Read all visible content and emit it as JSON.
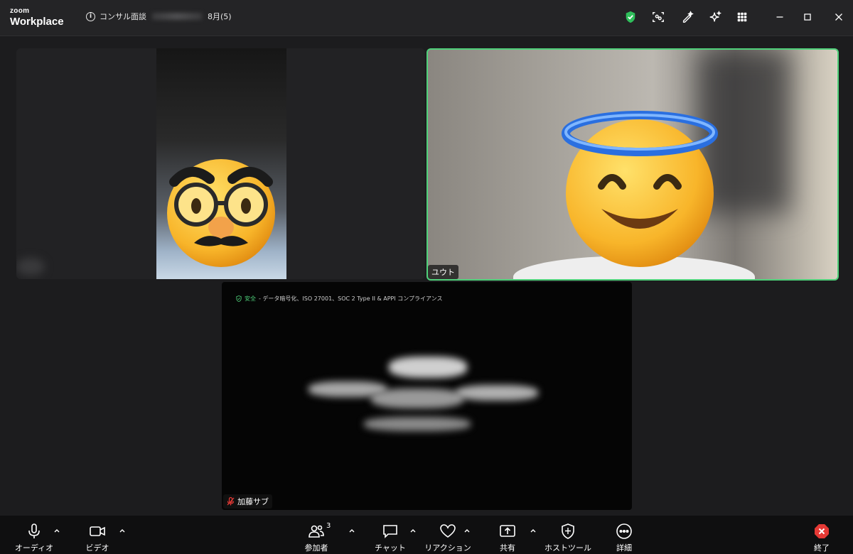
{
  "app": {
    "logo_small": "zoom",
    "logo_big": "Workplace"
  },
  "meeting": {
    "title_prefix": "コンサル面談",
    "title_suffix": "8月(5)"
  },
  "titlebar_icons": [
    "security-shield-icon",
    "focus-mode-icon",
    "ai-companion-edit-icon",
    "ai-sparkle-icon",
    "apps-grid-icon"
  ],
  "window_controls": [
    "minimize-icon",
    "maximize-icon",
    "close-icon"
  ],
  "colors": {
    "active_speaker": "#4fd17a",
    "end_button": "#e53935",
    "muted": "#e53935"
  },
  "participants": {
    "tile1": {
      "emoji": "disguise-face-icon"
    },
    "tile2": {
      "name": "ユウト",
      "emoji": "smiling-face-with-halo-icon"
    },
    "tile3": {
      "name": "加藤サブ",
      "mic_state": "muted"
    }
  },
  "share_banner": {
    "safe_label": "安全",
    "text": " - データ暗号化、ISO 27001、SOC 2 Type II & APPI コンプライアンス"
  },
  "toolbar": {
    "audio": "オーディオ",
    "video": "ビデオ",
    "participants": "参加者",
    "participants_count": "3",
    "chat": "チャット",
    "reactions": "リアクション",
    "share": "共有",
    "host_tools": "ホストツール",
    "more": "詳細",
    "end": "終了"
  }
}
